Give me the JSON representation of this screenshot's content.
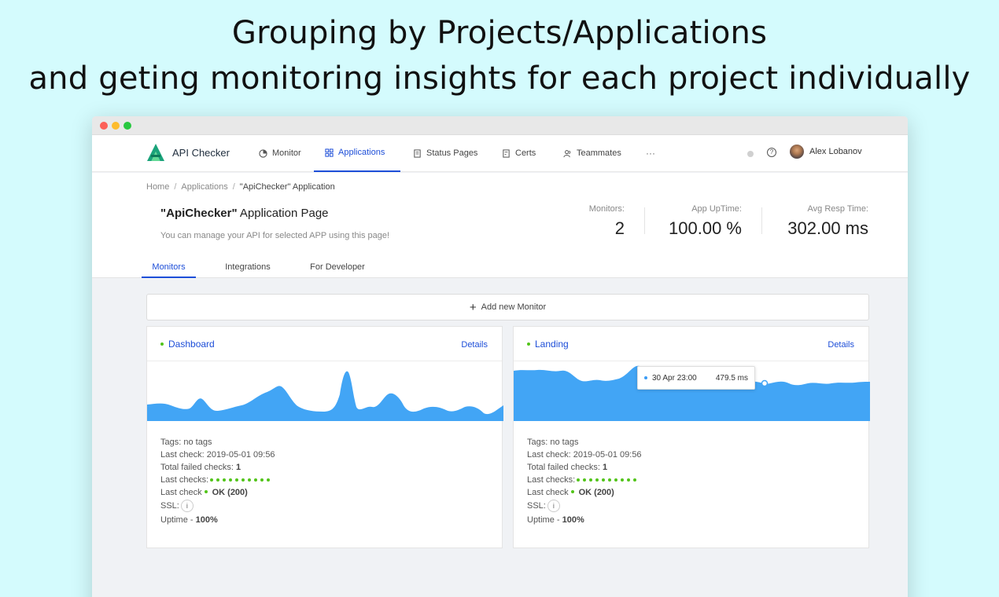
{
  "headline": {
    "line1": "Grouping by Projects/Applications",
    "line2": "and geting monitoring insights for each project individually"
  },
  "nav": {
    "brand": "API Checker",
    "items": [
      {
        "label": "Monitor",
        "icon": "pie-chart-icon"
      },
      {
        "label": "Applications",
        "icon": "grid-icon",
        "active": true
      },
      {
        "label": "Status Pages",
        "icon": "document-icon"
      },
      {
        "label": "Certs",
        "icon": "certificate-icon"
      },
      {
        "label": "Teammates",
        "icon": "users-icon"
      }
    ],
    "more": "···",
    "help": "?",
    "user": "Alex Lobanov"
  },
  "breadcrumb": [
    "Home",
    "Applications",
    "\"ApiChecker\" Application"
  ],
  "page": {
    "title_bold": "\"ApiChecker\"",
    "title_rest": " Application Page",
    "subtitle": "You can manage your API for selected APP using this page!"
  },
  "stats": {
    "monitors": {
      "label": "Monitors:",
      "value": "2"
    },
    "uptime": {
      "label": "App UpTime:",
      "value": "100.00 %"
    },
    "resp": {
      "label": "Avg Resp Time:",
      "value": "302.00 ms"
    }
  },
  "tabs": [
    "Monitors",
    "Integrations",
    "For Developer"
  ],
  "add_monitor": {
    "plus": "+",
    "label": "Add new Monitor"
  },
  "cards": [
    {
      "title": "Dashboard",
      "details": "Details",
      "tags_label": "Tags:",
      "tags": "no tags",
      "last_check_label": "Last check:",
      "last_check": "2019-05-01 09:56",
      "failed_label": "Total failed checks:",
      "failed": "1",
      "last_checks_label": "Last checks:",
      "last_checks_count": 10,
      "last_status_label": "Last check",
      "last_status": "OK (200)",
      "ssl_label": "SSL:",
      "ssl_icon": "i",
      "uptime_label": "Uptime -",
      "uptime": "100%"
    },
    {
      "title": "Landing",
      "details": "Details",
      "tags_label": "Tags:",
      "tags": "no tags",
      "last_check_label": "Last check:",
      "last_check": "2019-05-01 09:56",
      "failed_label": "Total failed checks:",
      "failed": "1",
      "last_checks_label": "Last checks:",
      "last_checks_count": 10,
      "last_status_label": "Last check",
      "last_status": "OK (200)",
      "ssl_label": "SSL:",
      "ssl_icon": "i",
      "uptime_label": "Uptime -",
      "uptime": "100%",
      "tooltip": {
        "date": "30 Apr 23:00",
        "value": "479.5 ms"
      }
    }
  ],
  "colors": {
    "accent": "#1d4ed8",
    "chart": "#42a5f5",
    "ok": "#52c41a",
    "background": "#d4fbfd"
  }
}
